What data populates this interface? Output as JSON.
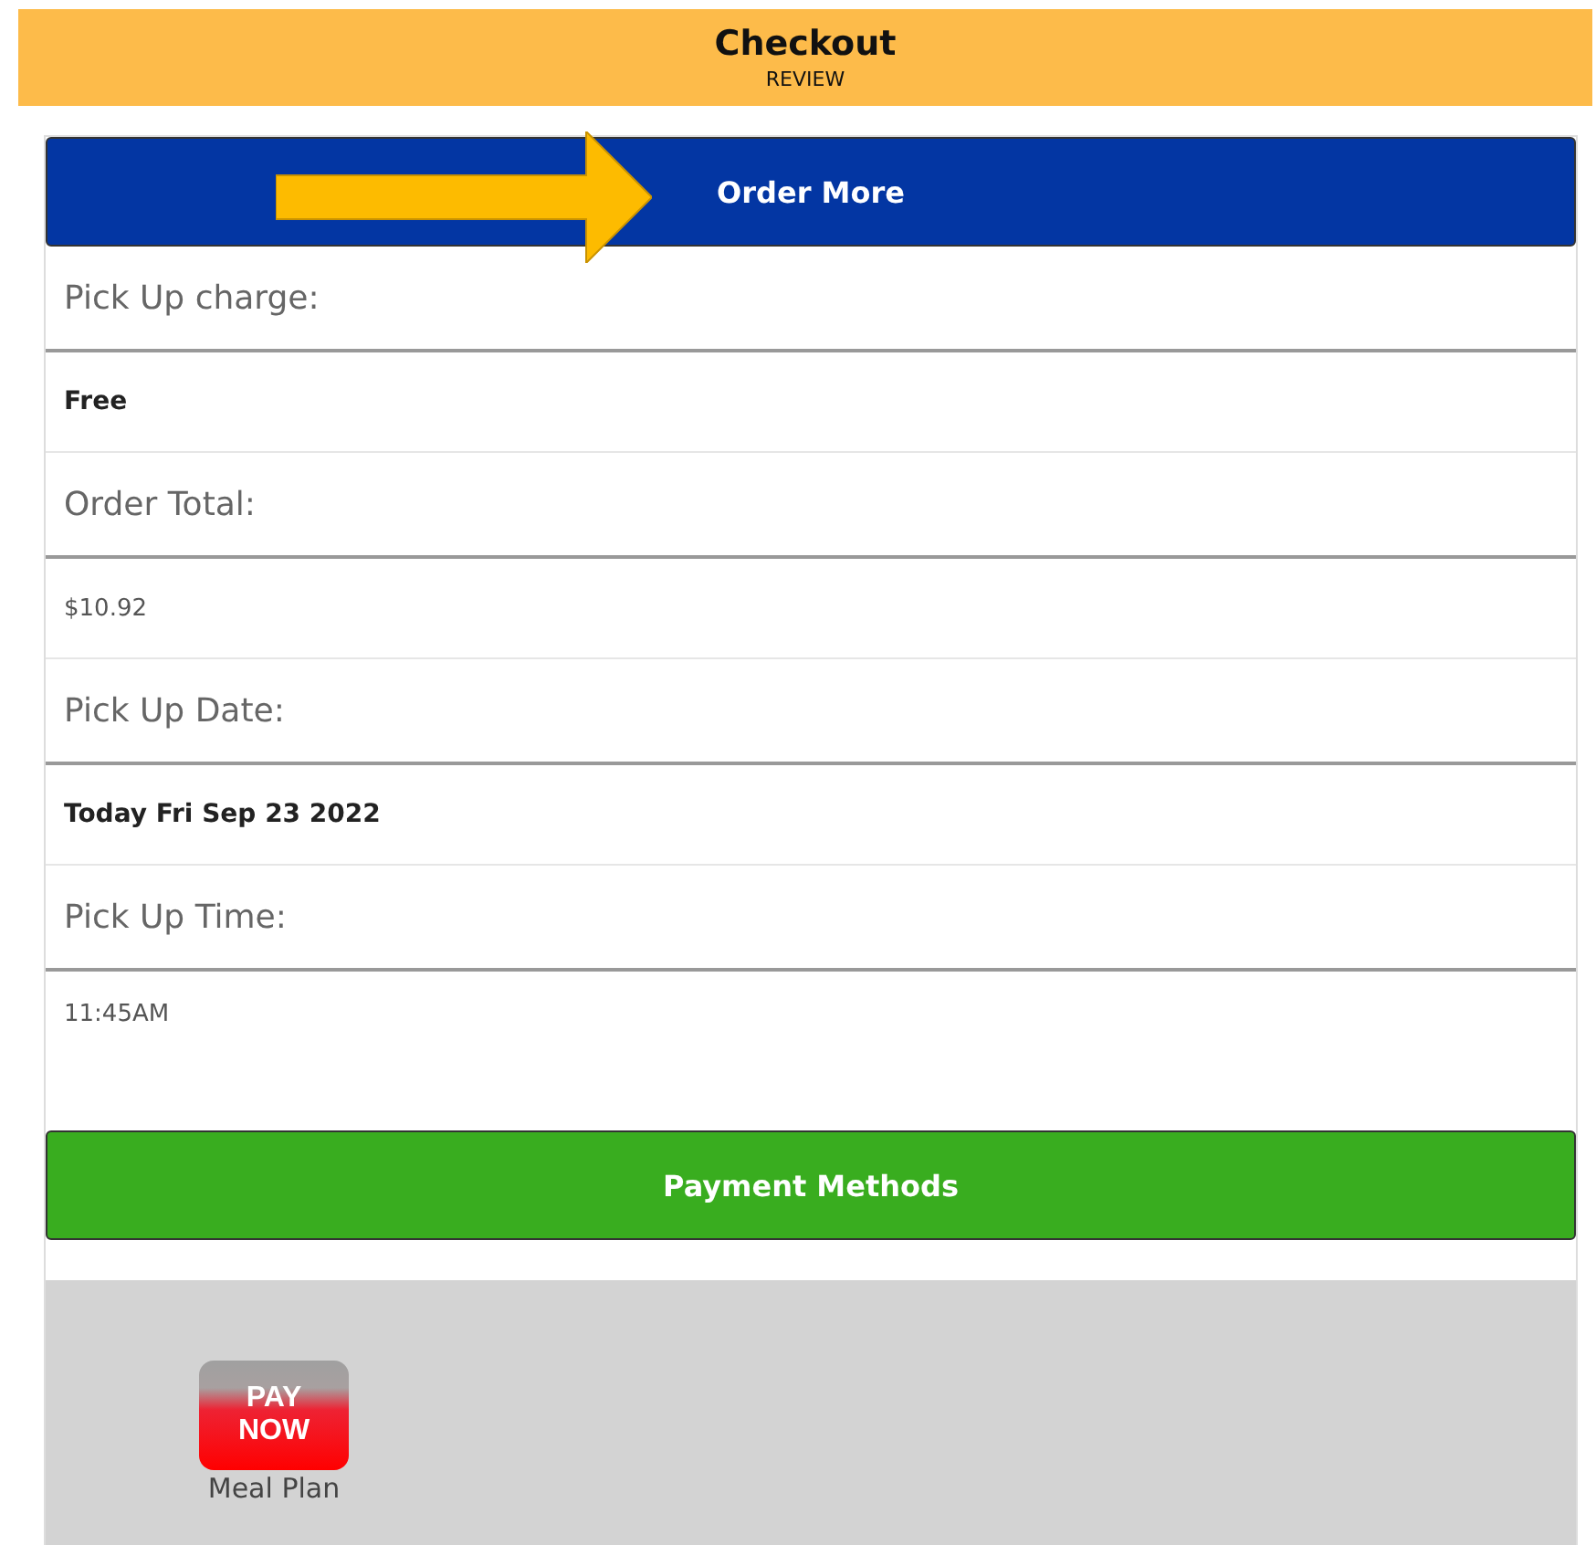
{
  "header": {
    "title": "Checkout",
    "subtitle": "REVIEW"
  },
  "order_more_button": "Order More",
  "fields": [
    {
      "label": "Pick Up charge:",
      "value": "Free",
      "kind": "bold"
    },
    {
      "label": "Order Total:",
      "value": "$10.92",
      "kind": "plain"
    },
    {
      "label": "Pick Up Date:",
      "value": "Today Fri Sep 23 2022",
      "kind": "bold"
    },
    {
      "label": "Pick Up Time:",
      "value": "11:45AM",
      "kind": "plain"
    }
  ],
  "payment_methods_button": "Payment Methods",
  "payment_options": [
    {
      "button": "PAY NOW",
      "caption": "Meal Plan"
    }
  ]
}
